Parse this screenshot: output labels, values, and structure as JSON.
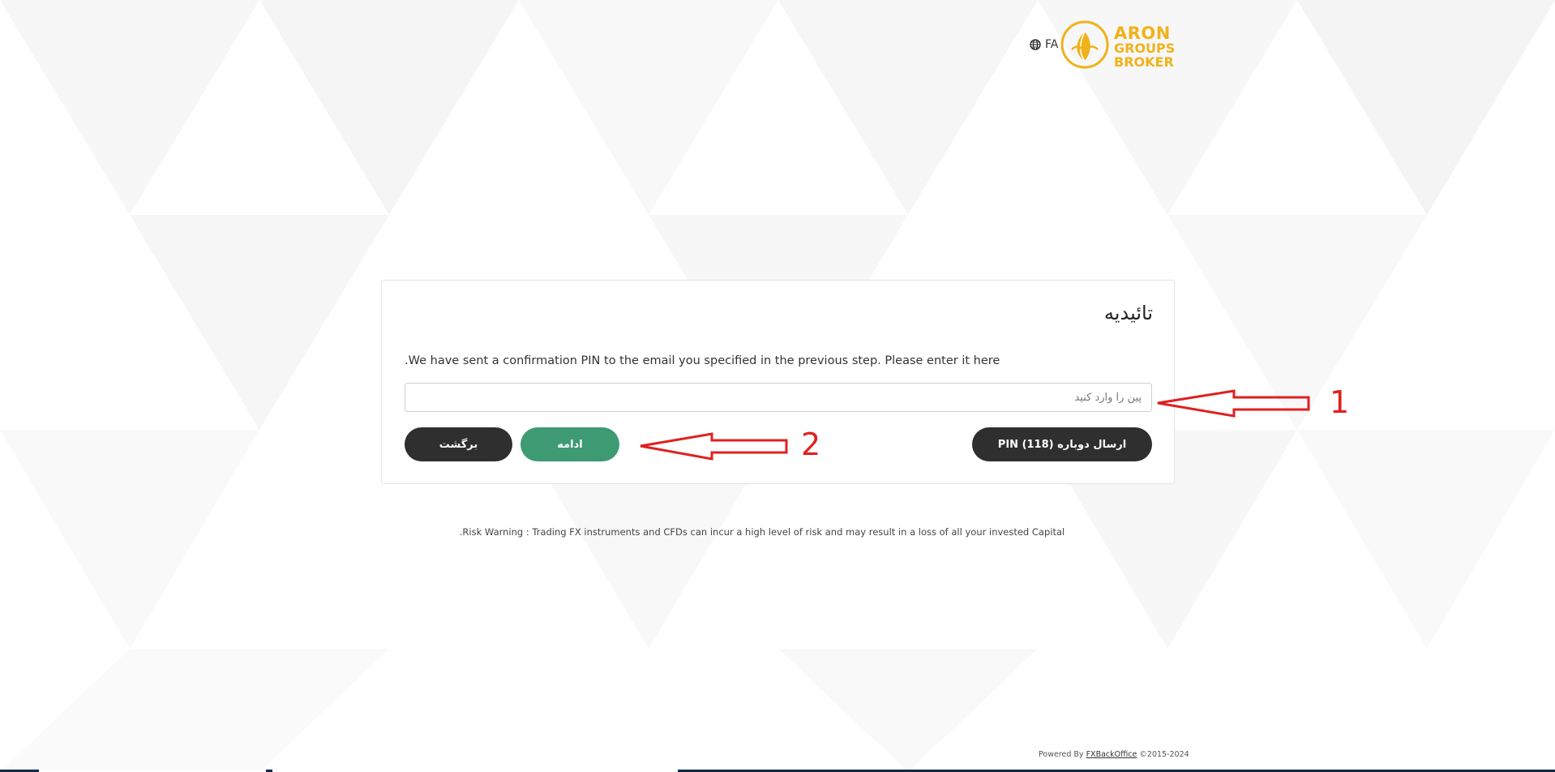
{
  "header": {
    "language_label": "FA",
    "logo": {
      "line1": "ARON",
      "line2": "GROUPS",
      "line3": "BROKER"
    }
  },
  "card": {
    "title": "تائیدیه",
    "message": ".We have sent a confirmation PIN to the email you specified in the previous step. Please enter it here",
    "pin_input": {
      "value": "",
      "placeholder": "پین را وارد کنید"
    },
    "buttons": {
      "resend_label": "ارسال دوباره PIN (118)",
      "continue_label": "ادامه",
      "back_label": "برگشت"
    }
  },
  "risk_warning": ".Risk Warning : Trading FX instruments and CFDs can incur a high level of risk and may result in a loss of all your invested Capital",
  "footer": {
    "powered_by": "Powered By",
    "link_text": "FXBackOffice",
    "years": "©2015-2024"
  },
  "annotations": {
    "label_1": "1",
    "label_2": "2",
    "color": "#e02020"
  },
  "colors": {
    "brand_gold": "#f0b21a",
    "button_dark": "#2f2f2f",
    "button_green": "#3d9a72"
  },
  "icons": {
    "language": "globe-icon",
    "logo": "leaf-circle-logo-icon"
  }
}
